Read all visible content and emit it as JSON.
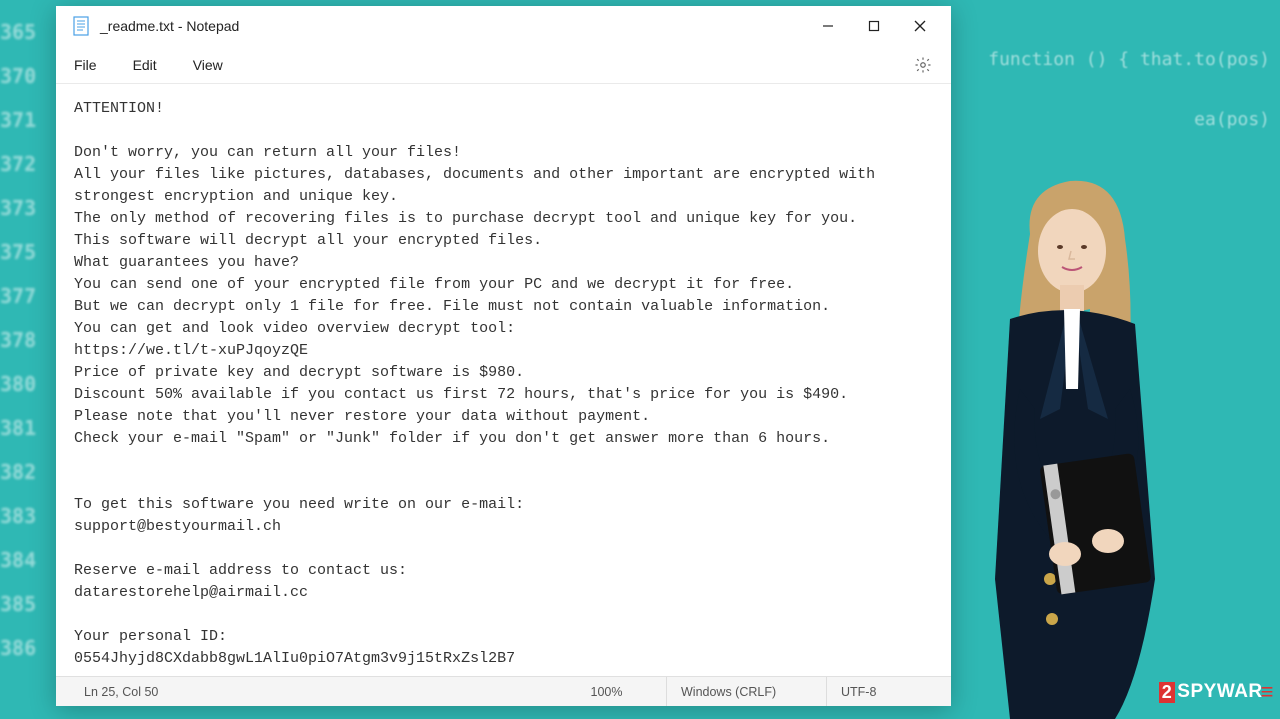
{
  "background": {
    "left_numbers": [
      "365",
      "370",
      "371",
      "372",
      "373",
      "375",
      "377",
      "378",
      "380",
      "381",
      "382",
      "383",
      "384",
      "385",
      "386"
    ],
    "right_snippets": [
      "function () { that.to(pos)",
      "ea(pos)"
    ]
  },
  "window": {
    "title": "_readme.txt - Notepad",
    "menu": {
      "file": "File",
      "edit": "Edit",
      "view": "View"
    },
    "content_lines": [
      "ATTENTION!",
      "",
      "Don't worry, you can return all your files!",
      "All your files like pictures, databases, documents and other important are encrypted with strongest encryption and unique key.",
      "The only method of recovering files is to purchase decrypt tool and unique key for you.",
      "This software will decrypt all your encrypted files.",
      "What guarantees you have?",
      "You can send one of your encrypted file from your PC and we decrypt it for free.",
      "But we can decrypt only 1 file for free. File must not contain valuable information.",
      "You can get and look video overview decrypt tool:",
      "https://we.tl/t-xuPJqoyzQE",
      "Price of private key and decrypt software is $980.",
      "Discount 50% available if you contact us first 72 hours, that's price for you is $490.",
      "Please note that you'll never restore your data without payment.",
      "Check your e-mail \"Spam\" or \"Junk\" folder if you don't get answer more than 6 hours.",
      "",
      "",
      "To get this software you need write on our e-mail:",
      "support@bestyourmail.ch",
      "",
      "Reserve e-mail address to contact us:",
      "datarestorehelp@airmail.cc",
      "",
      "Your personal ID:",
      "0554Jhyjd8CXdabb8gwL1AlIu0piO7Atgm3v9j15tRxZsl2B7"
    ],
    "statusbar": {
      "position": "Ln 25, Col 50",
      "zoom": "100%",
      "line_ending": "Windows (CRLF)",
      "encoding": "UTF-8"
    }
  },
  "watermark": {
    "prefix": "2",
    "text": "SPYWAR",
    "tail": "≡"
  }
}
